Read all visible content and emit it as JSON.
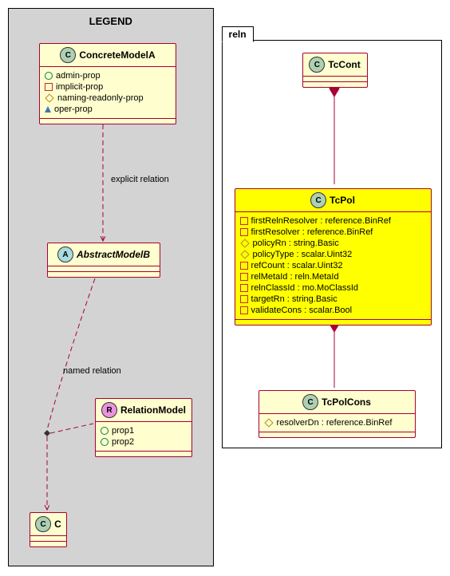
{
  "legend": {
    "title": "LEGEND",
    "concreteA": {
      "name": "ConcreteModelA",
      "letter": "C",
      "props": [
        {
          "marker": "circle",
          "text": "admin-prop"
        },
        {
          "marker": "square",
          "text": "implicit-prop"
        },
        {
          "marker": "diamond",
          "text": "naming-readonly-prop"
        },
        {
          "marker": "triangle",
          "text": "oper-prop"
        }
      ]
    },
    "rel_explicit": "explicit relation",
    "abstractB": {
      "name": "AbstractModelB",
      "letter": "A"
    },
    "rel_named": "named relation",
    "relationModel": {
      "name": "RelationModel",
      "letter": "R",
      "props": [
        {
          "marker": "circle",
          "text": "prop1"
        },
        {
          "marker": "circle",
          "text": "prop2"
        }
      ]
    },
    "classC": {
      "name": "C",
      "letter": "C"
    }
  },
  "package": {
    "name": "reln",
    "tcCont": {
      "name": "TcCont",
      "letter": "C"
    },
    "tcPol": {
      "name": "TcPol",
      "letter": "C",
      "props": [
        {
          "marker": "square",
          "text": "firstRelnResolver : reference.BinRef"
        },
        {
          "marker": "square",
          "text": "firstResolver : reference.BinRef"
        },
        {
          "marker": "diamond",
          "text": "policyRn : string.Basic"
        },
        {
          "marker": "diamond",
          "text": "policyType : scalar.Uint32"
        },
        {
          "marker": "square",
          "text": "refCount : scalar.Uint32"
        },
        {
          "marker": "square",
          "text": "relMetaId : reln.MetaId"
        },
        {
          "marker": "square",
          "text": "relnClassId : mo.MoClassId"
        },
        {
          "marker": "square",
          "text": "targetRn : string.Basic"
        },
        {
          "marker": "square",
          "text": "validateCons : scalar.Bool"
        }
      ]
    },
    "tcPolCons": {
      "name": "TcPolCons",
      "letter": "C",
      "props": [
        {
          "marker": "diamond",
          "text": "resolverDn : reference.BinRef"
        }
      ]
    }
  }
}
